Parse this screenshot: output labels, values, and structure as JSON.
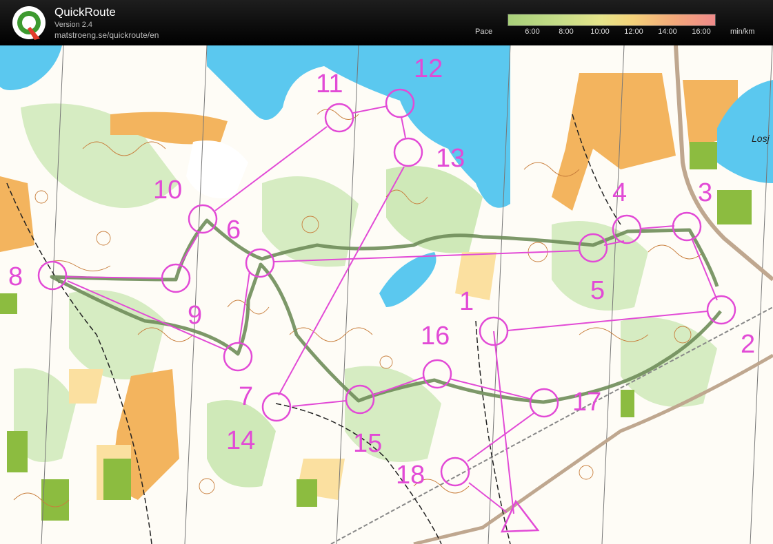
{
  "app": {
    "title": "QuickRoute",
    "version": "Version 2.4",
    "url": "matstroeng.se/quickroute/en"
  },
  "pace_scale": {
    "label": "Pace",
    "ticks": [
      "6:00",
      "8:00",
      "10:00",
      "12:00",
      "14:00",
      "16:00"
    ],
    "unit": "min/km"
  },
  "colors": {
    "course": "#e24ad6",
    "route": "#6f8d5a",
    "water": "#5bc8ef",
    "forest_green": "#c8e6b0",
    "open_orange": "#f3b45e",
    "contour": "#c87e3c"
  },
  "map": {
    "lake_label": "Losj",
    "controls": [
      {
        "label": "1"
      },
      {
        "label": "2"
      },
      {
        "label": "3"
      },
      {
        "label": "4"
      },
      {
        "label": "5"
      },
      {
        "label": "6"
      },
      {
        "label": "7"
      },
      {
        "label": "8"
      },
      {
        "label": "9"
      },
      {
        "label": "10"
      },
      {
        "label": "11"
      },
      {
        "label": "12"
      },
      {
        "label": "13"
      },
      {
        "label": "14"
      },
      {
        "label": "15"
      },
      {
        "label": "16"
      },
      {
        "label": "17"
      },
      {
        "label": "18"
      }
    ],
    "start_icon": "triangle-start-icon"
  }
}
